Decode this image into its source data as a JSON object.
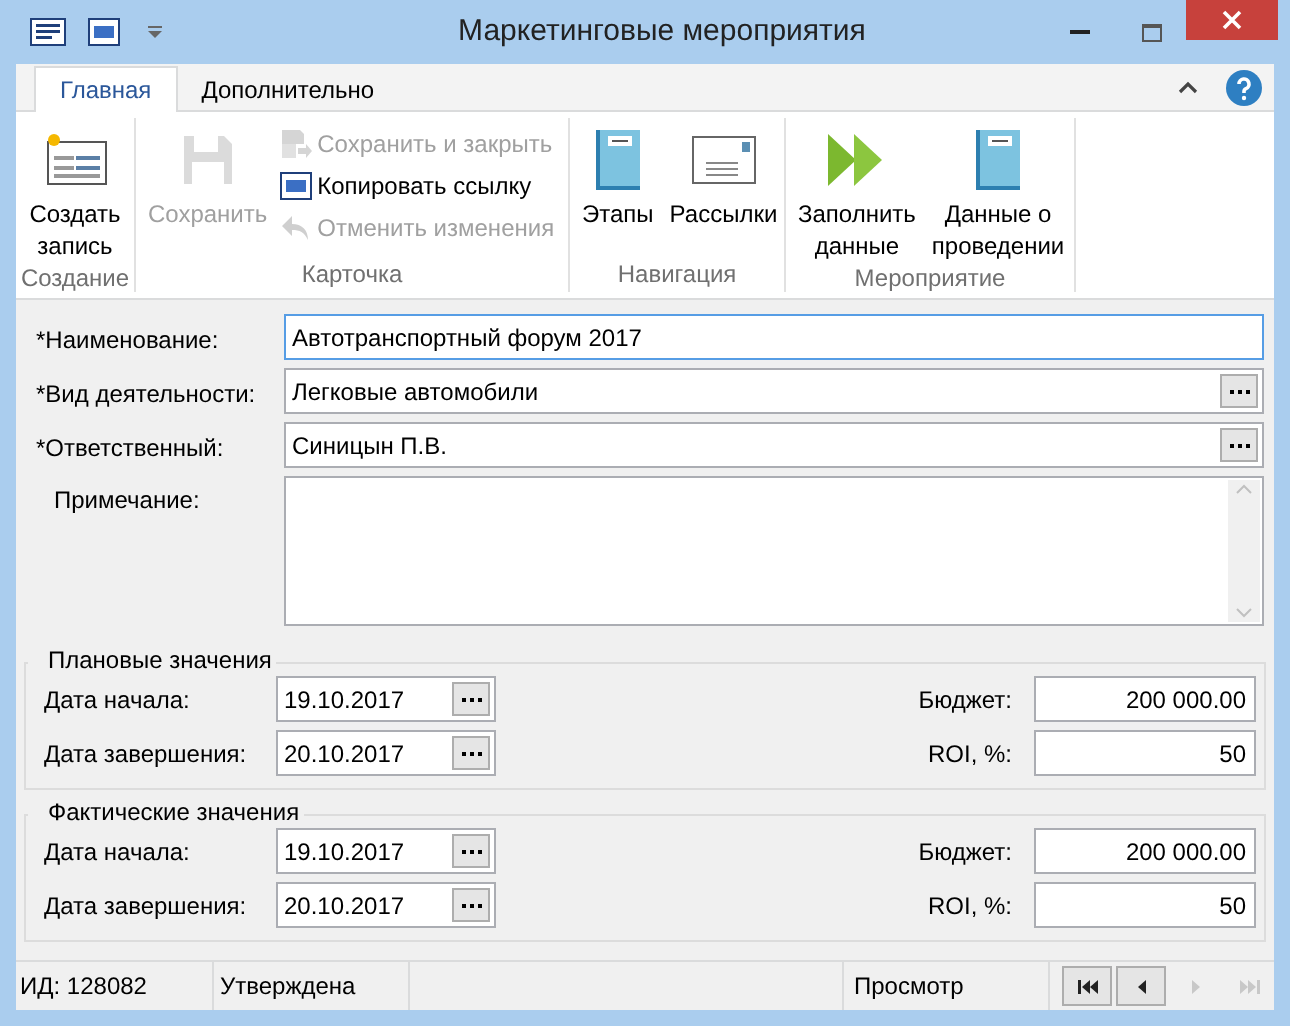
{
  "window": {
    "title": "Маркетинговые мероприятия"
  },
  "tabs": [
    {
      "label": "Главная",
      "selected": true
    },
    {
      "label": "Дополнительно",
      "selected": false
    }
  ],
  "ribbon_groups": [
    {
      "label": "Создание",
      "buttons": [
        {
          "kind": "large",
          "label": "Создать запись",
          "disabled": false
        }
      ]
    },
    {
      "label": "Карточка",
      "buttons": [
        {
          "kind": "large",
          "label": "Сохранить",
          "disabled": true
        },
        {
          "kind": "small",
          "label": "Сохранить и закрыть",
          "disabled": true
        },
        {
          "kind": "small",
          "label": "Копировать ссылку",
          "disabled": false
        },
        {
          "kind": "small",
          "label": "Отменить изменения",
          "disabled": true
        }
      ]
    },
    {
      "label": "Навигация",
      "buttons": [
        {
          "kind": "large",
          "label": "Этапы",
          "disabled": false
        },
        {
          "kind": "large",
          "label": "Рассылки",
          "disabled": false
        }
      ]
    },
    {
      "label": "Мероприятие",
      "buttons": [
        {
          "kind": "large",
          "label": "Заполнить данные",
          "disabled": false
        },
        {
          "kind": "large",
          "label": "Данные о проведении",
          "disabled": false
        }
      ]
    }
  ],
  "fields": [
    {
      "kind": "text",
      "label": "*Наименование:",
      "value": "Автотранспортный форум 2017",
      "focused": true
    },
    {
      "kind": "lookup",
      "label": "*Вид деятельности:",
      "value": "Легковые автомобили",
      "focused": false
    },
    {
      "kind": "lookup",
      "label": "*Ответственный:",
      "value": "Синицын П.В.",
      "focused": false
    },
    {
      "kind": "memo",
      "label": "Примечание:",
      "focused": false
    }
  ],
  "sections": [
    {
      "title": "Плановые значения",
      "rows": [
        {
          "date_label": "Дата начала:",
          "date": "19.10.2017",
          "num_label": "Бюджет:",
          "num": "200 000.00"
        },
        {
          "date_label": "Дата завершения:",
          "date": "20.10.2017",
          "num_label": "ROI, %:",
          "num": "50"
        }
      ]
    },
    {
      "title": "Фактические значения",
      "rows": [
        {
          "date_label": "Дата начала:",
          "date": "19.10.2017",
          "num_label": "Бюджет:",
          "num": "200 000.00"
        },
        {
          "date_label": "Дата завершения:",
          "date": "20.10.2017",
          "num_label": "ROI, %:",
          "num": "50"
        }
      ]
    }
  ],
  "status_bar": {
    "id": "ИД: 128082",
    "state": "Утверждена",
    "mode": "Просмотр",
    "nav": [
      {
        "kind": "first",
        "disabled": false
      },
      {
        "kind": "prev",
        "disabled": false
      },
      {
        "kind": "next",
        "disabled": true
      },
      {
        "kind": "last",
        "disabled": true
      }
    ]
  }
}
